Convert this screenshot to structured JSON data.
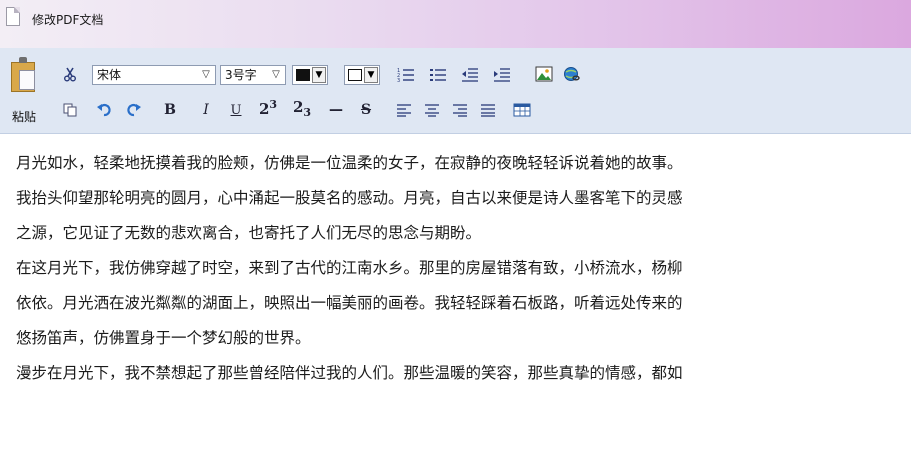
{
  "window": {
    "title": "修改PDF文档"
  },
  "toolbar": {
    "paste_label": "粘贴",
    "font": "宋体",
    "font_size": "3号字",
    "icons": {
      "cut": "scissors-icon",
      "copy": "copy-icon",
      "undo": "undo-icon",
      "redo": "redo-icon",
      "bold": "B",
      "italic": "I",
      "underline": "U",
      "superscript": "2",
      "superscript_exp": "3",
      "subscript": "2",
      "subscript_exp": "3",
      "hr": "—",
      "strike": "S"
    }
  },
  "content": {
    "lines": [
      "月光如水，轻柔地抚摸着我的脸颊，仿佛是一位温柔的女子，在寂静的夜晚轻轻诉说着她的故事。",
      "我抬头仰望那轮明亮的圆月，心中涌起一股莫名的感动。月亮，自古以来便是诗人墨客笔下的灵感",
      "之源，它见证了无数的悲欢离合，也寄托了人们无尽的思念与期盼。",
      "在这月光下，我仿佛穿越了时空，来到了古代的江南水乡。那里的房屋错落有致，小桥流水，杨柳",
      "依依。月光洒在波光粼粼的湖面上，映照出一幅美丽的画卷。我轻轻踩着石板路，听着远处传来的",
      "悠扬笛声，仿佛置身于一个梦幻般的世界。",
      "漫步在月光下，我不禁想起了那些曾经陪伴过我的人们。那些温暖的笑容，那些真挚的情感，都如"
    ]
  },
  "colors": {
    "toolbar_bg": "#dfe7f3",
    "title_gradient_end": "#dba8df"
  }
}
